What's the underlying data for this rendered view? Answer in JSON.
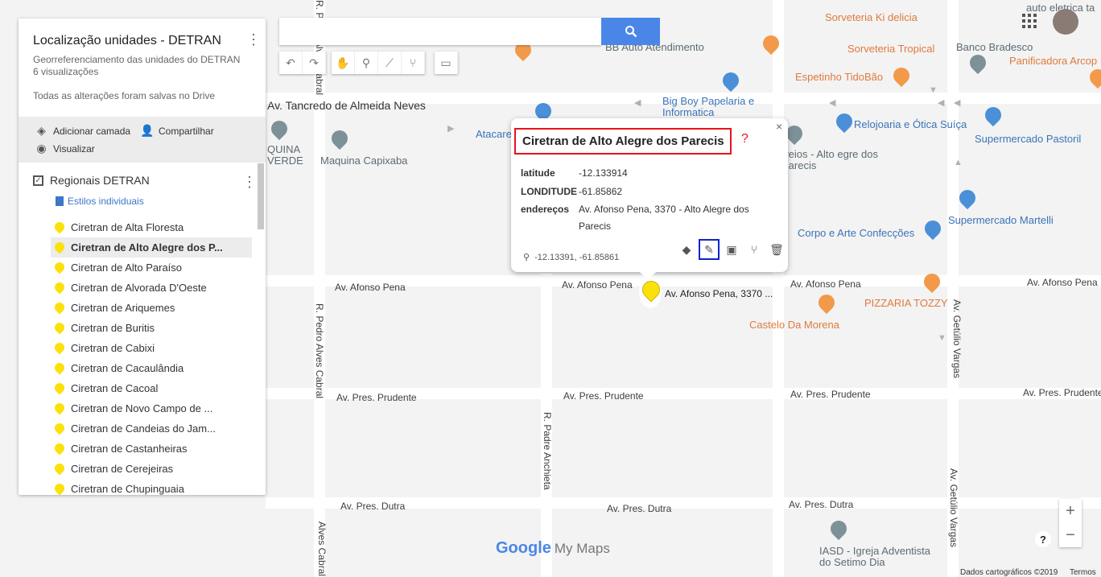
{
  "panel": {
    "title": "Localização unidades - DETRAN",
    "description": "Georreferenciamento das unidades do DETRAN",
    "views": "6 visualizações",
    "saved_status": "Todas as alterações foram salvas no Drive",
    "add_layer": "Adicionar camada",
    "share": "Compartilhar",
    "preview": "Visualizar",
    "layer_name": "Regionais DETRAN",
    "styles_link": "Estilos individuais",
    "locations": [
      "Ciretran de Alta Floresta",
      "Ciretran de Alto Alegre dos P...",
      "Ciretran de Alto Paraíso",
      "Ciretran de Alvorada D'Oeste",
      "Ciretran de Ariquemes",
      "Ciretran de Buritis",
      "Ciretran de Cabixi",
      "Ciretran de Cacaulândia",
      "Ciretran de Cacoal",
      "Ciretran de Novo Campo de ...",
      "Ciretran de Candeias do Jam...",
      "Ciretran de Castanheiras",
      "Ciretran de Cerejeiras",
      "Ciretran de Chupinguaia"
    ],
    "selected_index": 1
  },
  "search": {
    "placeholder": ""
  },
  "info": {
    "title": "Ciretran de Alto Alegre dos Parecis",
    "help": "?",
    "close": "×",
    "latitude_label": "latitude",
    "latitude_value": "-12.133914",
    "longitude_label": "LONDITUDE",
    "longitude_value": "-61.85862",
    "address_label": "endereços",
    "address_value": "Av. Afonso Pena, 3370 - Alto Alegre dos Parecis",
    "coords": "-12.13391, -61.85861"
  },
  "map": {
    "pin_label": "Av. Afonso Pena, 3370 ...",
    "streets": {
      "tancredo": "Av. Tancredo de Almeida Neves",
      "afonso1": "Av. Afonso Pena",
      "afonso2": "Av. Afonso Pena",
      "afonso3": "Av. Afonso Pena",
      "afonso4": "Av. Afonso Pena",
      "prudente1": "Av. Pres. Prudente",
      "prudente2": "Av. Pres. Prudente",
      "prudente3": "Av. Pres. Prudente",
      "prudente4": "Av. Pres. Prudente",
      "dutra1": "Av. Pres. Dutra",
      "dutra2": "Av. Pres. Dutra",
      "dutra3": "Av. Pres. Dutra",
      "pedro1": "R. Pedro Alves Cabral",
      "pedro2": "R. Pedro Alves Cabral",
      "pedro3": "Alves Cabral",
      "anchieta": "R. Padre Anchieta",
      "getulio1": "Av. Getúlio Vargas",
      "getulio2": "Av. Getúlio Vargas"
    },
    "pois": {
      "sorveteria_ki": "Sorveteria Ki delicia",
      "sorveteria_tropical": "Sorveteria Tropical",
      "banco": "Banco Bradesco",
      "panificadora": "Panificadora Arcop",
      "auto_eletrica": "auto eletrica ta",
      "bb_auto": "BB Auto Atendimento",
      "espetinho": "Espetinho TidoBão",
      "big_boy": "Big Boy Papelaria e Informatica",
      "relojoaria": "Relojoaria e Ótica Suíça",
      "supermercado_pastoril": "Supermercado Pastoril",
      "atacare": "Atacare",
      "maquina_verde": "QUINA VERDE",
      "maquina_capixaba": "Maquina Capixaba",
      "correios": "rreios - Alto egre dos Parecis",
      "supermercado_martelli": "Supermercado Martelli",
      "corpo_arte": "Corpo e Arte Confecções",
      "pizzaria": "PIZZARIA TOZZY",
      "castelo": "Castelo Da Morena",
      "iasd": "IASD - Igreja Adventista do Setimo Dia"
    }
  },
  "brand": {
    "google": "Google",
    "product": "My Maps"
  },
  "footer": {
    "copyright": "Dados cartográficos ©2019",
    "terms": "Termos"
  },
  "zoom": {
    "in": "+",
    "out": "−"
  },
  "help_button": "?"
}
